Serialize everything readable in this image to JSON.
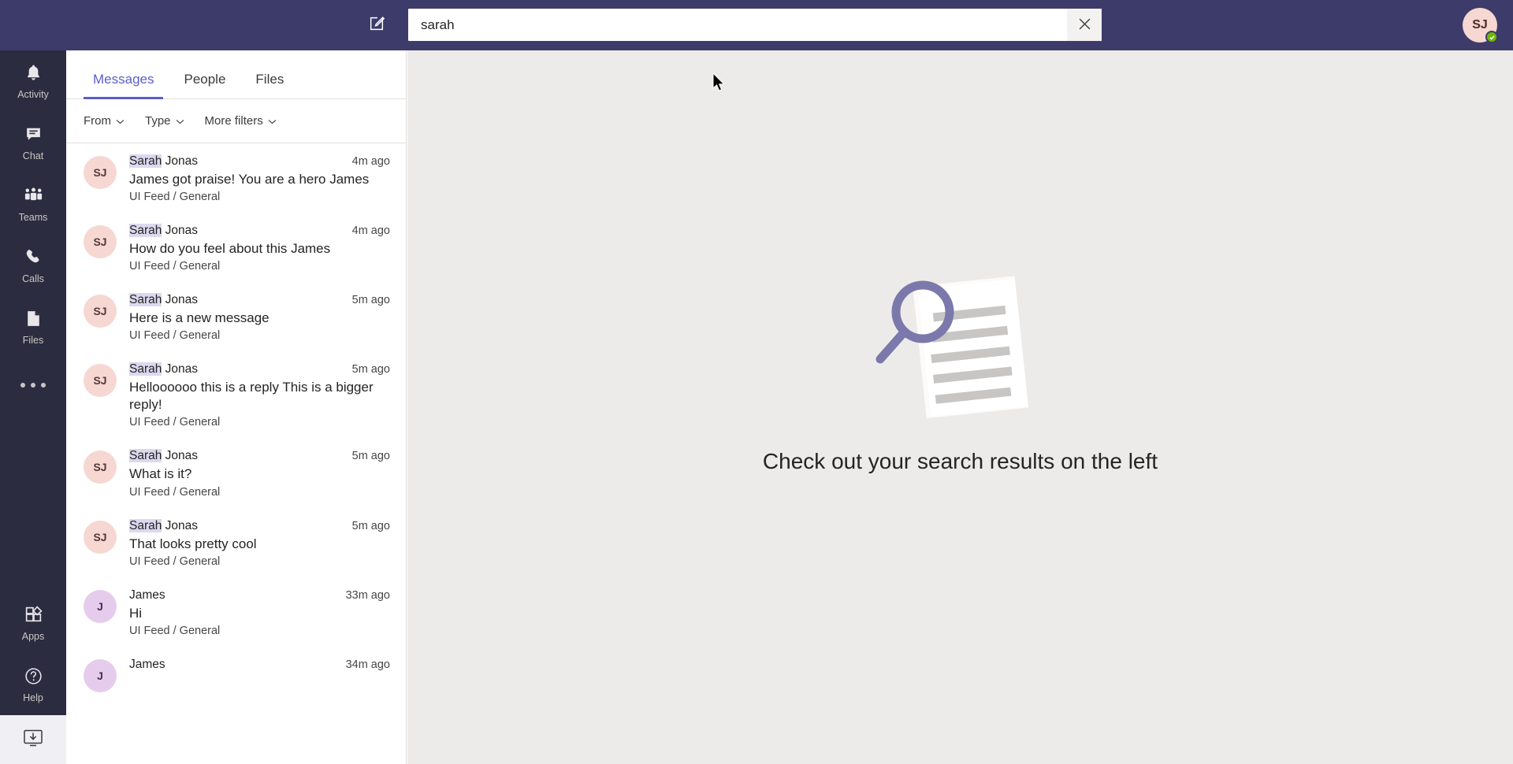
{
  "theme": {
    "header_bg": "#3d3b69",
    "rail_bg": "#2c2c40",
    "accent": "#5b5fc7",
    "main_bg": "#edebe9",
    "highlight_bg": "#dcd8ef",
    "presence_green": "#6bb700"
  },
  "header": {
    "compose_icon": "compose-icon",
    "search": {
      "value": "sarah",
      "placeholder": "Search",
      "clear_icon": "close-icon"
    },
    "avatar": {
      "initials": "SJ",
      "presence": "available"
    }
  },
  "rail": {
    "items": [
      {
        "label": "Activity",
        "icon": "bell-icon"
      },
      {
        "label": "Chat",
        "icon": "chat-icon"
      },
      {
        "label": "Teams",
        "icon": "teams-icon"
      },
      {
        "label": "Calls",
        "icon": "phone-icon"
      },
      {
        "label": "Files",
        "icon": "file-icon"
      }
    ],
    "more_icon": "ellipsis-icon",
    "bottom_items": [
      {
        "label": "Apps",
        "icon": "apps-icon"
      },
      {
        "label": "Help",
        "icon": "help-icon"
      }
    ],
    "download_icon": "download-desktop-icon"
  },
  "results": {
    "tabs": [
      {
        "label": "Messages",
        "active": true
      },
      {
        "label": "People",
        "active": false
      },
      {
        "label": "Files",
        "active": false
      }
    ],
    "filters": [
      {
        "label": "From",
        "icon": "chevron-down-icon"
      },
      {
        "label": "Type",
        "icon": "chevron-down-icon"
      },
      {
        "label": "More filters",
        "icon": "chevron-down-icon"
      }
    ],
    "messages": [
      {
        "avatar": "SJ",
        "avatar_style": "sj",
        "name_highlight": "Sarah",
        "name_rest": " Jonas",
        "time": "4m ago",
        "text": "James got praise! You are a hero James",
        "context": "UI Feed / General"
      },
      {
        "avatar": "SJ",
        "avatar_style": "sj",
        "name_highlight": "Sarah",
        "name_rest": " Jonas",
        "time": "4m ago",
        "text": "How do you feel about this James",
        "context": "UI Feed / General"
      },
      {
        "avatar": "SJ",
        "avatar_style": "sj",
        "name_highlight": "Sarah",
        "name_rest": " Jonas",
        "time": "5m ago",
        "text": "Here is a new message",
        "context": "UI Feed / General"
      },
      {
        "avatar": "SJ",
        "avatar_style": "sj",
        "name_highlight": "Sarah",
        "name_rest": " Jonas",
        "time": "5m ago",
        "text": "Helloooooo this is a reply This is a bigger reply!",
        "context": "UI Feed / General"
      },
      {
        "avatar": "SJ",
        "avatar_style": "sj",
        "name_highlight": "Sarah",
        "name_rest": " Jonas",
        "time": "5m ago",
        "text": "What is it?",
        "context": "UI Feed / General"
      },
      {
        "avatar": "SJ",
        "avatar_style": "sj",
        "name_highlight": "Sarah",
        "name_rest": " Jonas",
        "time": "5m ago",
        "text": "That looks pretty cool",
        "context": "UI Feed / General"
      },
      {
        "avatar": "J",
        "avatar_style": "j",
        "name_highlight": "",
        "name_rest": "James",
        "time": "33m ago",
        "text": "Hi",
        "context": "UI Feed / General"
      },
      {
        "avatar": "J",
        "avatar_style": "j",
        "name_highlight": "",
        "name_rest": "James",
        "time": "34m ago",
        "text": "",
        "context": ""
      }
    ]
  },
  "main": {
    "empty_illustration": "search-document-illustration",
    "empty_message": "Check out your search results on the left"
  }
}
